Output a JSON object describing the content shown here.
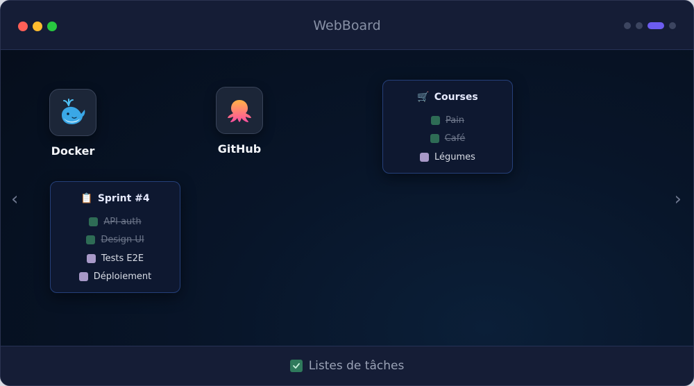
{
  "window": {
    "title": "WebBoard"
  },
  "pager": {
    "total": 4,
    "active_index": 2
  },
  "nav": {
    "prev_glyph": "‹",
    "next_glyph": "›"
  },
  "apps": [
    {
      "label": "Docker",
      "icon": "docker-whale-icon"
    },
    {
      "label": "GitHub",
      "icon": "github-octopus-icon"
    }
  ],
  "widgets": {
    "courses": {
      "emoji": "🛒",
      "title": "Courses",
      "items": [
        {
          "label": "Pain",
          "done": true
        },
        {
          "label": "Café",
          "done": true
        },
        {
          "label": "Légumes",
          "done": false
        }
      ]
    },
    "sprint": {
      "emoji": "📋",
      "title": "Sprint #4",
      "items": [
        {
          "label": "API auth",
          "done": true
        },
        {
          "label": "Design UI",
          "done": true
        },
        {
          "label": "Tests E2E",
          "done": false
        },
        {
          "label": "Déploiement",
          "done": false
        }
      ]
    }
  },
  "footer": {
    "label": "Listes de tâches",
    "icon": "checkbox-checked-icon"
  },
  "colors": {
    "accent": "#6c5cf0",
    "done_check": "#2e6c55",
    "todo_check": "#a899c8",
    "widget_border": "#25407a"
  }
}
